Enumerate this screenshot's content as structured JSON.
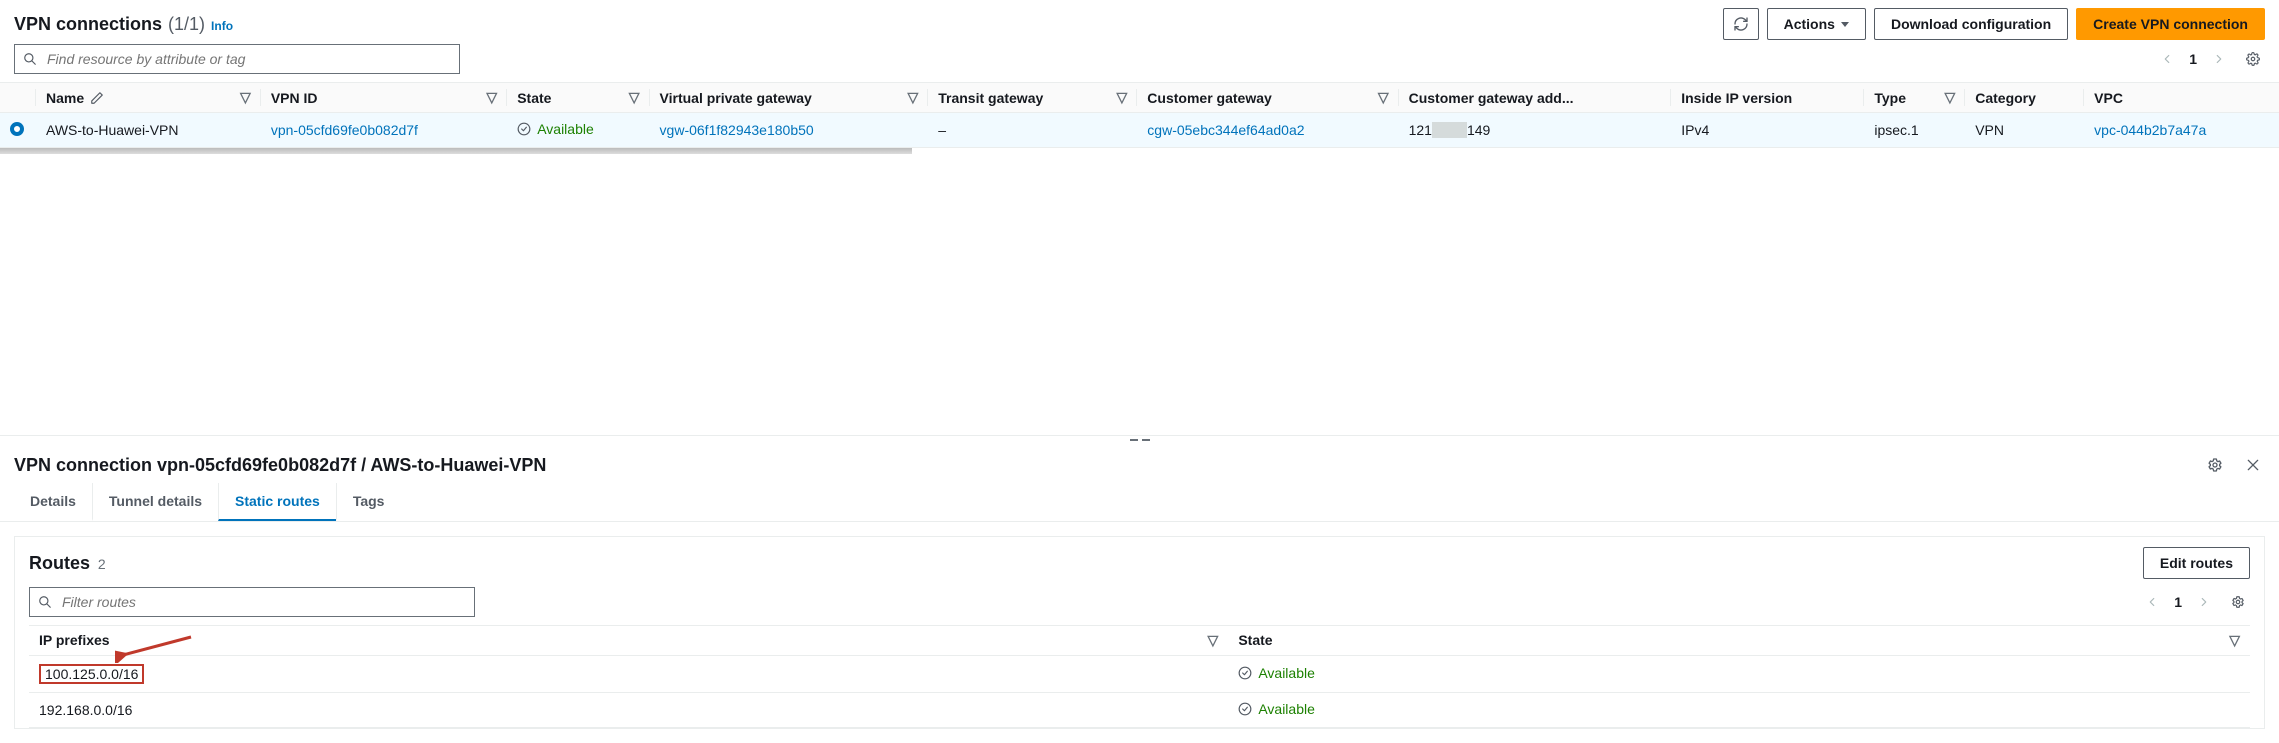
{
  "header": {
    "title": "VPN connections",
    "count_display": "(1/1)",
    "info": "Info",
    "actions_label": "Actions",
    "download_label": "Download configuration",
    "create_label": "Create VPN connection"
  },
  "search": {
    "placeholder": "Find resource by attribute or tag"
  },
  "pager": {
    "page": "1"
  },
  "columns": {
    "name": "Name",
    "vpn_id": "VPN ID",
    "state": "State",
    "vgw": "Virtual private gateway",
    "tgw": "Transit gateway",
    "cgw": "Customer gateway",
    "cgw_addr": "Customer gateway add...",
    "inside_ip": "Inside IP version",
    "type": "Type",
    "category": "Category",
    "vpc": "VPC"
  },
  "row": {
    "name": "AWS-to-Huawei-VPN",
    "vpn_id": "vpn-05cfd69fe0b082d7f",
    "state": "Available",
    "vgw": "vgw-06f1f82943e180b50",
    "tgw": "–",
    "cgw": "cgw-05ebc344ef64ad0a2",
    "cgw_addr_a": "121",
    "cgw_addr_mask": "xxxxx",
    "cgw_addr_b": "149",
    "inside_ip": "IPv4",
    "type": "ipsec.1",
    "category": "VPN",
    "vpc": "vpc-044b2b7a47a"
  },
  "detail": {
    "title": "VPN connection vpn-05cfd69fe0b082d7f / AWS-to-Huawei-VPN",
    "tabs": {
      "details": "Details",
      "tunnel": "Tunnel details",
      "static": "Static routes",
      "tags": "Tags"
    }
  },
  "routes": {
    "title": "Routes",
    "count": "2",
    "edit_label": "Edit routes",
    "filter_placeholder": "Filter routes",
    "pager_page": "1",
    "col_prefix": "IP prefixes",
    "col_state": "State",
    "rows": [
      {
        "prefix": "100.125.0.0/16",
        "state": "Available",
        "highlight": true
      },
      {
        "prefix": "192.168.0.0/16",
        "state": "Available",
        "highlight": false
      }
    ]
  }
}
